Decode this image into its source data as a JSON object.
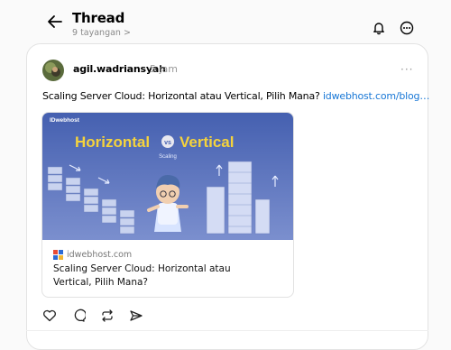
{
  "header": {
    "title": "Thread",
    "views": "9 tayangan >"
  },
  "post": {
    "username": "agil.wadriansyah",
    "time": "5 jam",
    "more": "···",
    "text": "Scaling Server Cloud: Horizontal atau Vertical, Pilih Mana? ",
    "link_text": "idwebhost.com/blog…",
    "link_card": {
      "brand": "IDwebhost",
      "headline_left": "Horizontal",
      "headline_vs": "vs",
      "headline_right": "Vertical",
      "caption": "Scaling",
      "domain": "idwebhost.com",
      "title": "Scaling Server Cloud: Horizontal atau Vertical, Pilih Mana?"
    }
  },
  "icons": [
    "arrow-left-icon",
    "bell-icon",
    "more-circle-icon",
    "heart-icon",
    "comment-icon",
    "repost-icon",
    "send-icon"
  ],
  "colors": {
    "link": "#1877d6",
    "banner_bg": "#3d5ba8",
    "headline_yellow": "#f5d33c",
    "vs_bg": "#e8e8f0"
  }
}
